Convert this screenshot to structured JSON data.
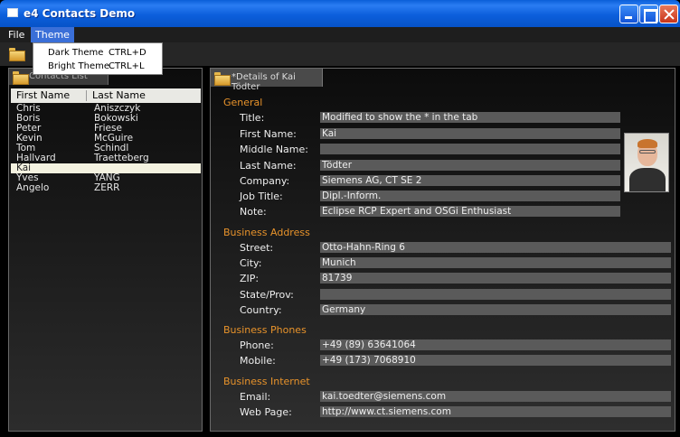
{
  "window": {
    "title": "e4 Contacts Demo"
  },
  "menu": {
    "file": "File",
    "theme": "Theme",
    "theme_items": [
      {
        "label": "Dark Theme",
        "accel": "CTRL+D"
      },
      {
        "label": "Bright Theme",
        "accel": "CTRL+L"
      }
    ]
  },
  "contacts_view": {
    "tab_label": "Contacts List",
    "columns": [
      "First Name",
      "Last Name"
    ],
    "rows": [
      {
        "first": "Chris",
        "last": "Aniszczyk"
      },
      {
        "first": "Boris",
        "last": "Bokowski"
      },
      {
        "first": "Peter",
        "last": "Friese"
      },
      {
        "first": "Kevin",
        "last": "McGuire"
      },
      {
        "first": "Tom",
        "last": "Schindl"
      },
      {
        "first": "Hallvard",
        "last": "Traetteberg"
      },
      {
        "first": "Kai",
        "last": "Tödter",
        "selected": true
      },
      {
        "first": "Yves",
        "last": "YANG"
      },
      {
        "first": "Angelo",
        "last": "ZERR"
      }
    ]
  },
  "details_view": {
    "tab_label": "*Details of Kai Tödter",
    "general": {
      "header": "General",
      "title_label": "Title:",
      "title_value": "Modified to show the * in the tab",
      "first_label": "First Name:",
      "first_value": "Kai",
      "middle_label": "Middle Name:",
      "middle_value": "",
      "last_label": "Last Name:",
      "last_value": "Tödter",
      "company_label": "Company:",
      "company_value": "Siemens AG, CT SE 2",
      "job_label": "Job Title:",
      "job_value": "Dipl.-Inform.",
      "note_label": "Note:",
      "note_value": "Eclipse RCP Expert and OSGi Enthusiast"
    },
    "address": {
      "header": "Business Address",
      "street_label": "Street:",
      "street_value": "Otto-Hahn-Ring 6",
      "city_label": "City:",
      "city_value": "Munich",
      "zip_label": "ZIP:",
      "zip_value": "81739",
      "state_label": "State/Prov:",
      "state_value": "",
      "country_label": "Country:",
      "country_value": "Germany"
    },
    "phones": {
      "header": "Business Phones",
      "phone_label": "Phone:",
      "phone_value": "+49 (89) 63641064",
      "mobile_label": "Mobile:",
      "mobile_value": "+49 (173) 7068910"
    },
    "internet": {
      "header": "Business Internet",
      "email_label": "Email:",
      "email_value": "kai.toedter@siemens.com",
      "web_label": "Web Page:",
      "web_value": "http://www.ct.siemens.com"
    }
  },
  "colors": {
    "accent": "#e8932b",
    "selection": "#3a6fd8",
    "field_bg": "#5a5a5a"
  }
}
